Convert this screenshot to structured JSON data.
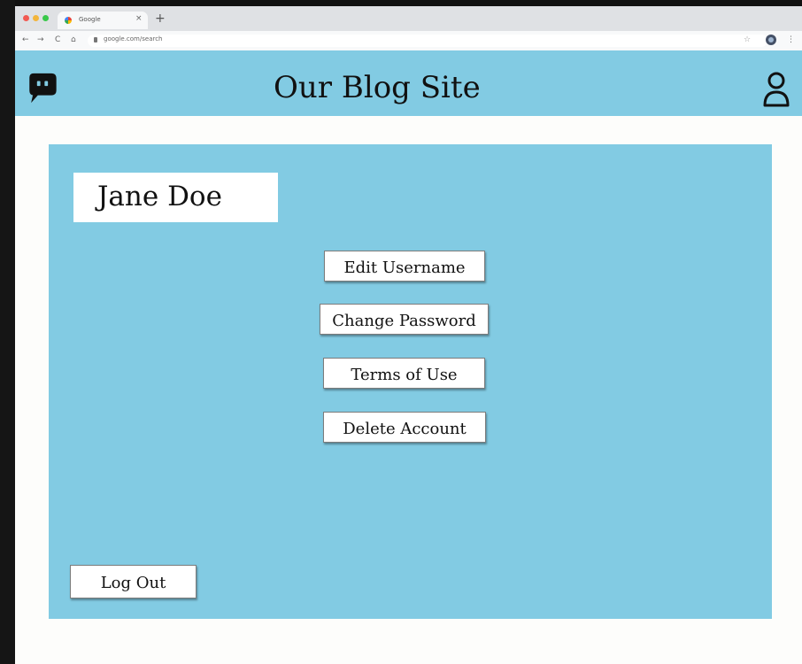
{
  "browser": {
    "tab_title": "Google",
    "tab_close_icon": "×",
    "new_tab_icon": "+",
    "back_icon": "←",
    "forward_icon": "→",
    "reload_icon": "C",
    "home_icon": "⌂",
    "address": "google.com/search",
    "bookmark_icon": "☆",
    "menu_icon": "⋮"
  },
  "header": {
    "title": "Our Blog Site",
    "logo_icon": "chat-bubble-icon",
    "account_icon": "user-icon"
  },
  "profile": {
    "name": "Jane Doe"
  },
  "actions": {
    "edit_username": "Edit Username",
    "change_password": "Change Password",
    "terms_of_use": "Terms of Use",
    "delete_account": "Delete Account",
    "log_out": "Log Out"
  },
  "colors": {
    "accent": "#82cbe3",
    "page_background": "#fdfdfb",
    "button_background": "#ffffff",
    "text": "#111111"
  }
}
